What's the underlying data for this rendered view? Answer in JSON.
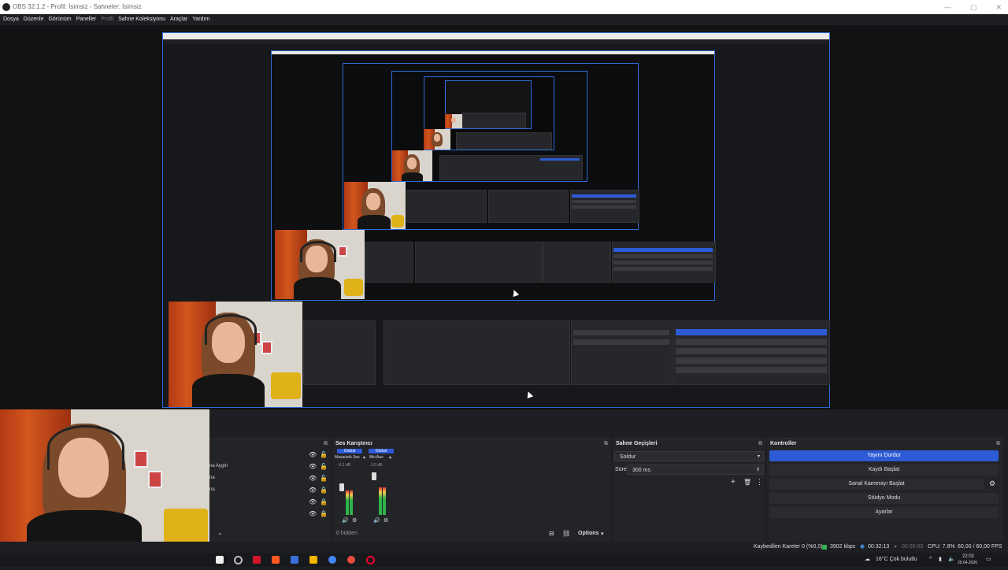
{
  "window": {
    "title": "OBS 32.1.2 - Profil: İsimsiz - Sahneler: İsimsiz",
    "minimize": "—",
    "maximize": "▢",
    "close": "✕"
  },
  "menu": [
    {
      "label": "Dosya",
      "dim": false
    },
    {
      "label": "Düzenle",
      "dim": false
    },
    {
      "label": "Görünüm",
      "dim": false
    },
    {
      "label": "Paneller",
      "dim": false
    },
    {
      "label": "Profil",
      "dim": true
    },
    {
      "label": "Sahne Koleksiyonu",
      "dim": false
    },
    {
      "label": "Araçlar",
      "dim": false
    },
    {
      "label": "Yardım",
      "dim": false
    }
  ],
  "sources": {
    "items": [
      "na Aygıtı",
      "na",
      "na"
    ],
    "footer_icon": "chevron-down-icon"
  },
  "mixer": {
    "title": "Ses Karıştırıcı",
    "channels": [
      {
        "tag": "Global",
        "name": "Masaüstü Ses",
        "db": "-9.1 dB",
        "level": 0.55
      },
      {
        "tag": "Global",
        "name": "Mic/Aux",
        "db": "0.0 dB",
        "level": 0.62
      }
    ],
    "hidden": "0 hidden",
    "options": "Options"
  },
  "transitions": {
    "title": "Sahne Geçişleri",
    "type": "Soldur",
    "duration_label": "Süre",
    "duration": "300 ms"
  },
  "controls": {
    "title": "Kontroller",
    "buttons": [
      "Yayını Durdur",
      "Kaydı Başlat",
      "Sanal Kamerayı Başlat",
      "Stüdyo Modu",
      "Ayarlar"
    ]
  },
  "status": {
    "dropped": "Kaybedilen Kareler 0 (%0,0)",
    "bitrate": "3902 kbps",
    "stream_time": "00:32:13",
    "rec_time": "00:00:00",
    "cpu": "CPU: 7.8%",
    "fps": "60,00 / 60,00 FPS"
  },
  "taskbar": {
    "weather": "16°C  Çok bulutlu",
    "time": "22:02",
    "date": "29.04.2026"
  },
  "colors": {
    "accent": "#2d5bd6",
    "live_green": "#2fb34a"
  }
}
